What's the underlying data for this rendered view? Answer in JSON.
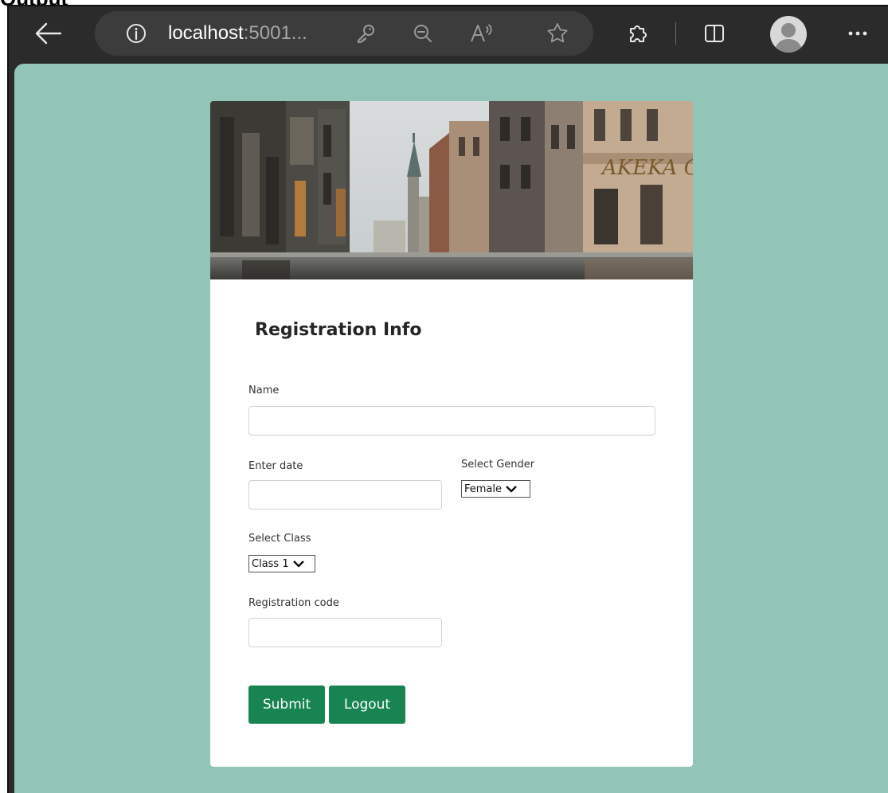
{
  "page_label": "Output",
  "browser": {
    "url_host": "localhost",
    "url_rest": ":5001..."
  },
  "icons": {
    "back": "back-arrow-icon",
    "info": "info-icon",
    "key": "key-icon",
    "zoom": "zoom-out-icon",
    "read_aloud": "read-aloud-icon",
    "favorite": "star-icon",
    "extensions": "puzzle-icon",
    "split": "split-screen-icon",
    "profile": "profile-avatar",
    "menu": "more-icon"
  },
  "form": {
    "title": "Registration Info",
    "name_label": "Name",
    "date_label": "Enter date",
    "gender_label": "Select Gender",
    "gender_value": "Female",
    "class_label": "Select Class",
    "class_value": "Class 1",
    "code_label": "Registration code",
    "submit_label": "Submit",
    "logout_label": "Logout"
  },
  "colors": {
    "page_bg": "#92c5b8",
    "button": "#178452",
    "toolbar": "#2b2b2b"
  }
}
